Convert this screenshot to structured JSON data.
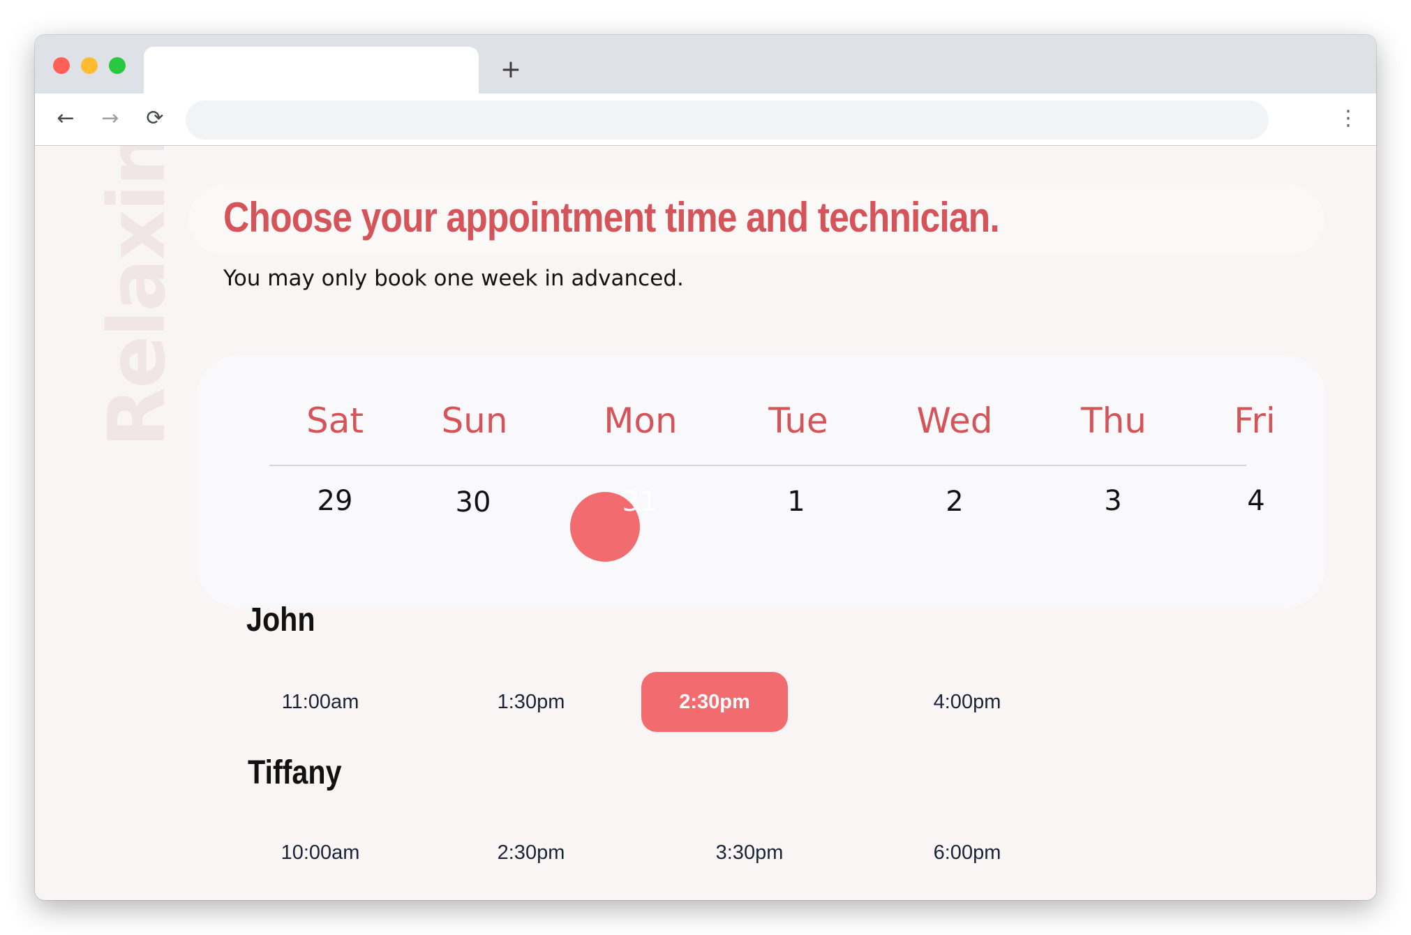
{
  "browser": {
    "new_tab_label": "+",
    "back_icon": "←",
    "forward_icon": "→",
    "reload_icon": "⟳",
    "menu_icon": "⋮",
    "address": ""
  },
  "watermark": "Relaxing",
  "heading": "Choose your appointment time and technician.",
  "subheading": "You may only book one week in advanced.",
  "calendar": {
    "days": [
      {
        "name": "Sat",
        "date": "29"
      },
      {
        "name": "Sun",
        "date": "30"
      },
      {
        "name": "Mon",
        "date": "31"
      },
      {
        "name": "Tue",
        "date": "1"
      },
      {
        "name": "Wed",
        "date": "2"
      },
      {
        "name": "Thu",
        "date": "3"
      },
      {
        "name": "Fri",
        "date": "4"
      }
    ],
    "selected_date": "31"
  },
  "technicians": [
    {
      "name": "John",
      "slots": [
        "11:00am",
        "1:30pm",
        "2:30pm",
        "4:00pm"
      ],
      "selected_slot": "2:30pm"
    },
    {
      "name": "Tiffany",
      "slots": [
        "10:00am",
        "2:30pm",
        "3:30pm",
        "6:00pm"
      ],
      "selected_slot": null
    }
  ],
  "colors": {
    "accent": "#d5545a",
    "selected_fill": "#f26b6e",
    "page_background": "#faf5f5"
  }
}
